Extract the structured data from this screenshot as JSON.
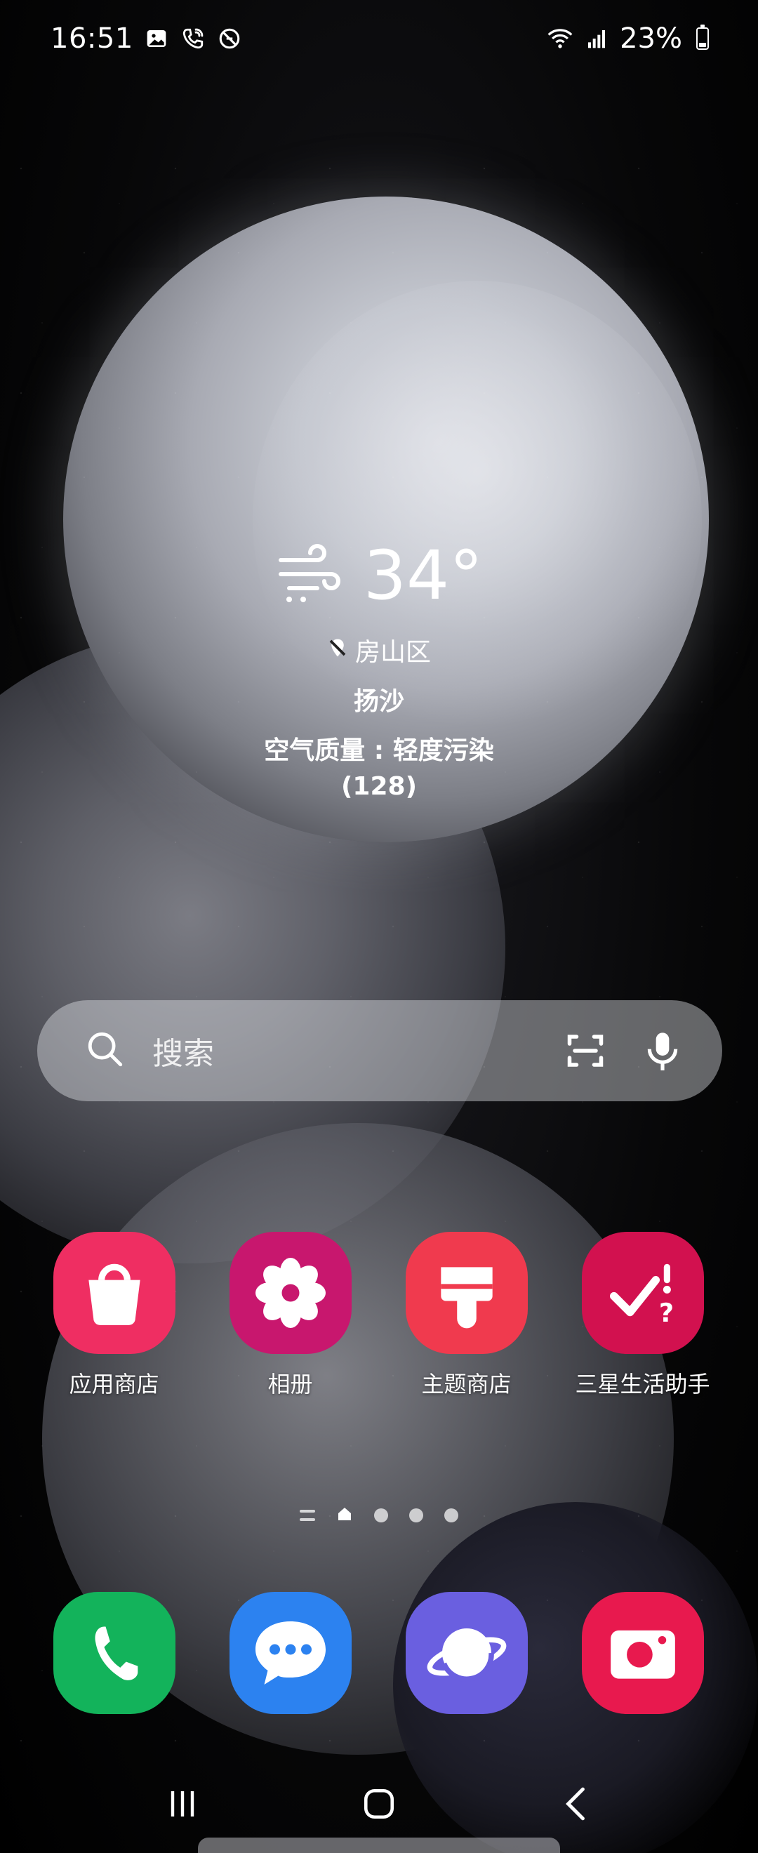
{
  "status_bar": {
    "time": "16:51",
    "battery_percent": "23%",
    "battery_level": 0.23,
    "icons": [
      "gallery-icon",
      "wifi-calling-icon",
      "no-disturb-icon",
      "wifi-icon",
      "signal-icon",
      "battery-icon"
    ]
  },
  "weather": {
    "temperature": "34°",
    "location": "房山区",
    "condition": "扬沙",
    "air_quality": "空气质量 : 轻度污染",
    "aqi_value": "(128)",
    "icon": "windy-icon"
  },
  "search": {
    "placeholder": "搜索",
    "icons": [
      "search-icon",
      "scan-icon",
      "microphone-icon"
    ]
  },
  "apps": [
    {
      "label": "应用商店",
      "icon": "galaxy-store-icon",
      "color": "#ef2e62"
    },
    {
      "label": "相册",
      "icon": "gallery-flower-icon",
      "color": "#c8176e"
    },
    {
      "label": "主题商店",
      "icon": "themes-brush-icon",
      "color": "#f03a4e"
    },
    {
      "label": "三星生活助手",
      "icon": "reminder-check-icon",
      "color": "#d2114f"
    }
  ],
  "page_indicator": {
    "pages": 4,
    "current": 1
  },
  "dock": [
    {
      "icon": "phone-icon",
      "color": "#13b35b"
    },
    {
      "icon": "messages-icon",
      "color": "#2c82f0"
    },
    {
      "icon": "internet-browser-icon",
      "color": "#6a5fe0"
    },
    {
      "icon": "camera-icon",
      "color": "#e8194e"
    }
  ],
  "nav": {
    "buttons": [
      "recents-button",
      "home-button",
      "back-button"
    ]
  }
}
